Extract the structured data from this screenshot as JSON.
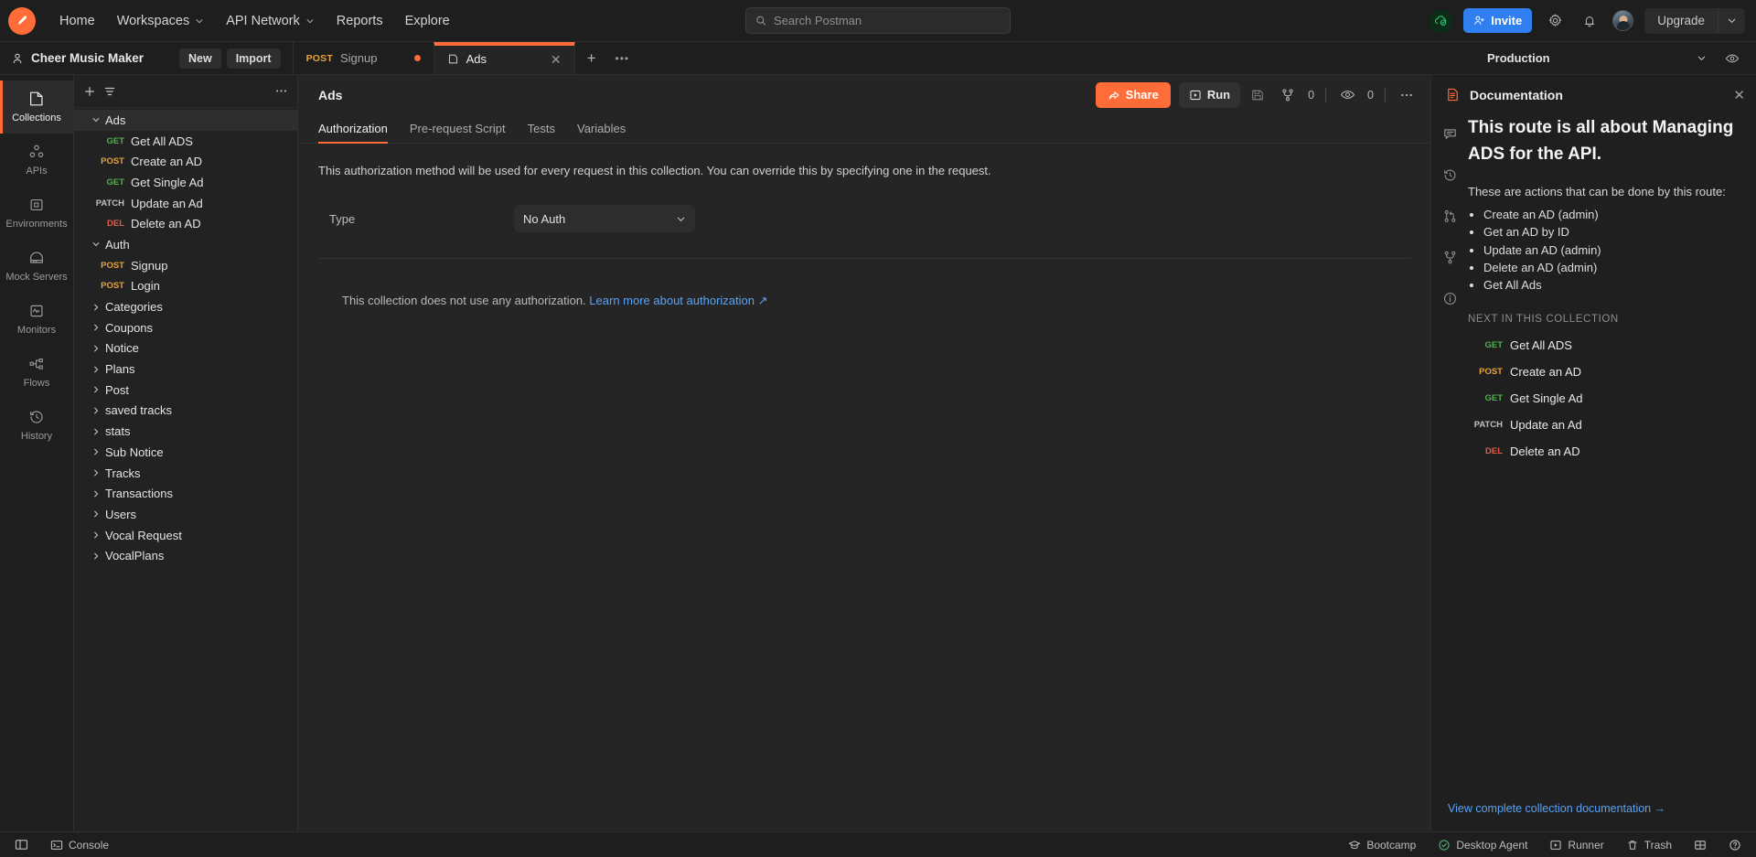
{
  "topbar": {
    "nav": [
      {
        "label": "Home",
        "caret": false
      },
      {
        "label": "Workspaces",
        "caret": true
      },
      {
        "label": "API Network",
        "caret": true
      },
      {
        "label": "Reports",
        "caret": false
      },
      {
        "label": "Explore",
        "caret": false
      }
    ],
    "search_placeholder": "Search Postman",
    "search_value": "",
    "invite_label": "Invite",
    "upgrade_label": "Upgrade",
    "accent_color": "#ff6c37",
    "invite_color": "#2f7ff0"
  },
  "tabbar": {
    "workspace_name": "Cheer Music Maker",
    "new_label": "New",
    "import_label": "Import",
    "tabs": [
      {
        "method": "POST",
        "label": "Signup",
        "active": false,
        "unsaved": true
      },
      {
        "method": "",
        "label": "Ads",
        "active": true,
        "unsaved": false
      }
    ],
    "environment": "Production"
  },
  "rail": {
    "items": [
      {
        "label": "Collections",
        "icon": "collections-icon",
        "active": true
      },
      {
        "label": "APIs",
        "icon": "apis-icon",
        "active": false
      },
      {
        "label": "Environments",
        "icon": "environments-icon",
        "active": false
      },
      {
        "label": "Mock Servers",
        "icon": "mock-servers-icon",
        "active": false
      },
      {
        "label": "Monitors",
        "icon": "monitors-icon",
        "active": false
      },
      {
        "label": "Flows",
        "icon": "flows-icon",
        "active": false
      },
      {
        "label": "History",
        "icon": "history-icon",
        "active": false
      }
    ]
  },
  "sidebar": {
    "search_placeholder": "",
    "tree": [
      {
        "level": 1,
        "type": "folder",
        "label": "Ads",
        "expanded": true,
        "selected": true
      },
      {
        "level": 2,
        "type": "request",
        "method": "GET",
        "label": "Get All ADS"
      },
      {
        "level": 2,
        "type": "request",
        "method": "POST",
        "label": "Create an AD"
      },
      {
        "level": 2,
        "type": "request",
        "method": "GET",
        "label": "Get Single Ad"
      },
      {
        "level": 2,
        "type": "request",
        "method": "PATCH",
        "label": "Update an Ad"
      },
      {
        "level": 2,
        "type": "request",
        "method": "DEL",
        "label": "Delete an AD"
      },
      {
        "level": 1,
        "type": "folder",
        "label": "Auth",
        "expanded": true,
        "selected": false
      },
      {
        "level": 2,
        "type": "request",
        "method": "POST",
        "label": "Signup"
      },
      {
        "level": 2,
        "type": "request",
        "method": "POST",
        "label": "Login"
      },
      {
        "level": 1,
        "type": "folder",
        "label": "Categories",
        "expanded": false,
        "selected": false
      },
      {
        "level": 1,
        "type": "folder",
        "label": "Coupons",
        "expanded": false,
        "selected": false
      },
      {
        "level": 1,
        "type": "folder",
        "label": "Notice",
        "expanded": false,
        "selected": false
      },
      {
        "level": 1,
        "type": "folder",
        "label": "Plans",
        "expanded": false,
        "selected": false
      },
      {
        "level": 1,
        "type": "folder",
        "label": "Post",
        "expanded": false,
        "selected": false
      },
      {
        "level": 1,
        "type": "folder",
        "label": "saved tracks",
        "expanded": false,
        "selected": false
      },
      {
        "level": 1,
        "type": "folder",
        "label": "stats",
        "expanded": false,
        "selected": false
      },
      {
        "level": 1,
        "type": "folder",
        "label": "Sub Notice",
        "expanded": false,
        "selected": false
      },
      {
        "level": 1,
        "type": "folder",
        "label": "Tracks",
        "expanded": false,
        "selected": false
      },
      {
        "level": 1,
        "type": "folder",
        "label": "Transactions",
        "expanded": false,
        "selected": false
      },
      {
        "level": 1,
        "type": "folder",
        "label": "Users",
        "expanded": false,
        "selected": false
      },
      {
        "level": 1,
        "type": "folder",
        "label": "Vocal Request",
        "expanded": false,
        "selected": false
      },
      {
        "level": 1,
        "type": "folder",
        "label": "VocalPlans",
        "expanded": false,
        "selected": false
      }
    ]
  },
  "main": {
    "collection_title": "Ads",
    "share_label": "Share",
    "run_label": "Run",
    "fork_count": "0",
    "watch_count": "0",
    "tabs": [
      {
        "label": "Authorization",
        "active": true
      },
      {
        "label": "Pre-request Script",
        "active": false
      },
      {
        "label": "Tests",
        "active": false
      },
      {
        "label": "Variables",
        "active": false
      }
    ],
    "auth_note": "This authorization method will be used for every request in this collection. You can override this by specifying one in the request.",
    "type_label": "Type",
    "type_value": "No Auth",
    "empty_text": "This collection does not use any authorization.",
    "empty_link": "Learn more about authorization ↗"
  },
  "docs": {
    "panel_title": "Documentation",
    "heading": "This route is all about Managing ADS for the API.",
    "intro": "These are actions that can be done by this route:",
    "bullets": [
      "Create an AD (admin)",
      "Get an AD by ID",
      "Update an AD (admin)",
      "Delete an AD (admin)",
      "Get All Ads"
    ],
    "section_title": "NEXT IN THIS COLLECTION",
    "next_items": [
      {
        "method": "GET",
        "label": "Get All ADS"
      },
      {
        "method": "POST",
        "label": "Create an AD"
      },
      {
        "method": "GET",
        "label": "Get Single Ad"
      },
      {
        "method": "PATCH",
        "label": "Update an Ad"
      },
      {
        "method": "DEL",
        "label": "Delete an AD"
      }
    ],
    "footer_link": "View complete collection documentation  →",
    "rail_icons": [
      "documentation-icon",
      "comments-icon",
      "activity-icon",
      "pull-requests-icon",
      "forks-icon",
      "info-icon"
    ]
  },
  "statusbar": {
    "console_label": "Console",
    "right_items": [
      {
        "label": "Bootcamp",
        "icon": "bootcamp-icon"
      },
      {
        "label": "Desktop Agent",
        "icon": "check-circle-icon"
      },
      {
        "label": "Runner",
        "icon": "runner-icon"
      },
      {
        "label": "Trash",
        "icon": "trash-icon"
      }
    ]
  }
}
